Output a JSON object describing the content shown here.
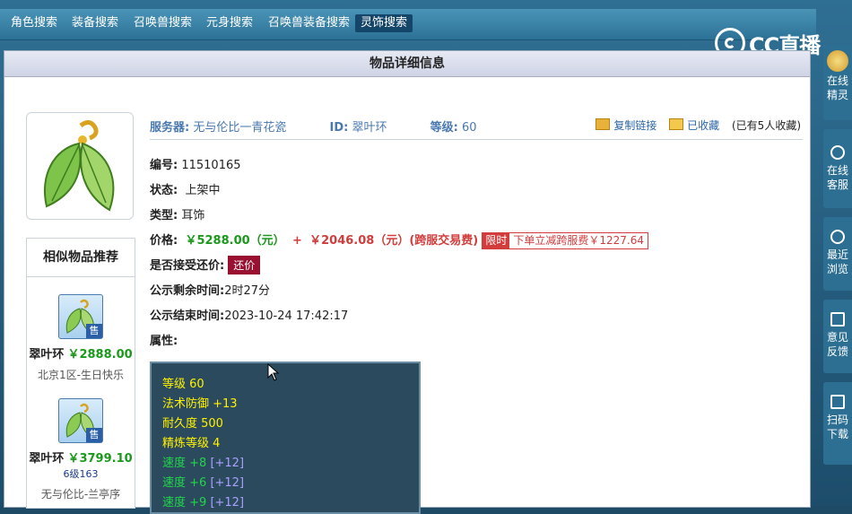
{
  "nav": {
    "tabs": [
      {
        "label": "角色搜索"
      },
      {
        "label": "装备搜索"
      },
      {
        "label": "召唤兽搜索"
      },
      {
        "label": "元身搜索"
      },
      {
        "label": "召唤兽装备搜索"
      },
      {
        "label": "灵饰搜索"
      }
    ],
    "active_tab": "灵饰搜索"
  },
  "logo": {
    "text": "CC直播"
  },
  "page_header": {
    "title": "物品详细信息"
  },
  "similar": {
    "title": "相似物品推荐",
    "items": [
      {
        "name": "翠叶环",
        "price": "￥2888.00",
        "badge": "售",
        "sub": "",
        "server": "北京1区-生日快乐"
      },
      {
        "name": "翠叶环",
        "price": "￥3799.10",
        "badge": "售",
        "sub": "6级163",
        "server": "无与伦比-兰亭序"
      }
    ]
  },
  "item": {
    "server_label": "服务器:",
    "server": "无与伦比一青花瓷",
    "id_label": "ID:",
    "id": "翠叶环",
    "level_label": "等级:",
    "level": "60",
    "copy_link": "复制链接",
    "favorited": "已收藏",
    "fav_count": "(已有5人收藏)",
    "serial_label": "编号:",
    "serial": "11510165",
    "status_label": "状态:",
    "status": "上架中",
    "type_label": "类型:",
    "type": "耳饰",
    "price_label": "价格:",
    "price": "￥5288.00（元）",
    "plus": "+",
    "fee": "￥2046.08（元）(跨服交易费)",
    "limit_tag": "限时",
    "limit_text": "下单立减跨服费￥1227.64",
    "bargain_label": "是否接受还价:",
    "bargain_btn": "还价",
    "remain_label": "公示剩余时间:",
    "remain": "2时27分",
    "end_label": "公示结束时间:",
    "end": "2023-10-24 17:42:17",
    "attr_label": "属性:"
  },
  "attributes": [
    {
      "text": "等级 60",
      "color": "yellow",
      "bonus": ""
    },
    {
      "text": "法术防御 +13",
      "color": "yellow",
      "bonus": ""
    },
    {
      "text": "耐久度 500",
      "color": "yellow",
      "bonus": ""
    },
    {
      "text": "精炼等级 4",
      "color": "yellow",
      "bonus": ""
    },
    {
      "text": "速度 +8",
      "color": "green",
      "bonus": "[+12]"
    },
    {
      "text": "速度 +6",
      "color": "green",
      "bonus": "[+12]"
    },
    {
      "text": "速度 +9",
      "color": "green",
      "bonus": "[+12]"
    }
  ],
  "rail": [
    {
      "label1": "在线",
      "label2": "精灵",
      "icon": "avatar-icon"
    },
    {
      "label1": "在线",
      "label2": "客服",
      "icon": "headset-icon"
    },
    {
      "label1": "最近",
      "label2": "浏览",
      "icon": "clock-icon"
    },
    {
      "label1": "意见",
      "label2": "反馈",
      "icon": "edit-icon"
    },
    {
      "label1": "扫码",
      "label2": "下载",
      "icon": "scan-icon"
    }
  ],
  "colors": {
    "price_green": "#1a9a1a",
    "price_red": "#d23c3c",
    "attr_yellow": "#fff200",
    "attr_green": "#22d64a",
    "bonus_purple": "#a9a0ff",
    "link_blue": "#4a79b0"
  }
}
